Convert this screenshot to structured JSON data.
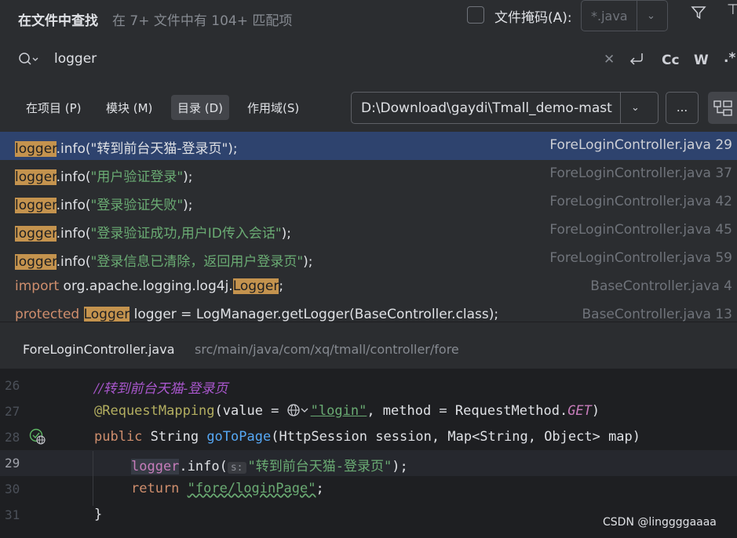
{
  "header": {
    "title": "在文件中查找",
    "subtitle": "在 7+ 文件中有 104+ 匹配项",
    "file_mask_label": "文件掩码(A):",
    "file_mask_value": "*.java"
  },
  "search": {
    "query": "logger",
    "case_toggle": "Cc",
    "word_toggle": "W",
    "regex_toggle": ".*"
  },
  "scope": {
    "tabs": [
      {
        "label": "在项目 (P)"
      },
      {
        "label": "模块 (M)"
      },
      {
        "label": "目录 (D)",
        "active": true
      },
      {
        "label": "作用域(S)"
      }
    ],
    "directory": "D:\\Download\\gaydi\\Tmall_demo-mast",
    "browse_label": "..."
  },
  "results": [
    {
      "match": "logger",
      "after": ".info(",
      "string": "\"转到前台天猫-登录页\"",
      "tail": ");",
      "file": "ForeLoginController.java 29",
      "selected": true
    },
    {
      "match": "logger",
      "after": ".info(",
      "string": "\"用户验证登录\"",
      "tail": ");",
      "file": "ForeLoginController.java 37"
    },
    {
      "match": "logger",
      "after": ".info(",
      "string": "\"登录验证失败\"",
      "tail": ");",
      "file": "ForeLoginController.java 42"
    },
    {
      "match": "logger",
      "after": ".info(",
      "string": "\"登录验证成功,用户ID传入会话\"",
      "tail": ");",
      "file": "ForeLoginController.java 45"
    },
    {
      "match": "logger",
      "after": ".info(",
      "string": "\"登录信息已清除，返回用户登录页\"",
      "tail": ");",
      "file": "ForeLoginController.java 59"
    },
    {
      "prefix_kw": "import",
      "prefix": " org.apache.logging.log4j.",
      "match": "Logger",
      "tail": ";",
      "file": "BaseController.java 4"
    },
    {
      "prefix_kw": "protected",
      "prefix": " ",
      "match": "Logger",
      "tail": " logger = LogManager.getLogger(BaseController.class);",
      "file": "BaseController.java 13"
    }
  ],
  "preview": {
    "file_name": "ForeLoginController.java",
    "file_path": "src/main/java/com/xq/tmall/controller/fore"
  },
  "code": {
    "lines": [
      {
        "no": "26"
      },
      {
        "no": "27"
      },
      {
        "no": "28"
      },
      {
        "no": "29"
      },
      {
        "no": "30"
      },
      {
        "no": "31"
      }
    ],
    "l26_comment": "//转到前台天猫-登录页",
    "l27_annot": "@RequestMapping",
    "l27_a": "(value = ",
    "l27_str": "\"login\"",
    "l27_b": ", method = RequestMethod.",
    "l27_const": "GET",
    "l27_c": ")",
    "l28_kw": "public",
    "l28_a": " String ",
    "l28_fn": "goToPage",
    "l28_b": "(HttpSession session, Map<String, Object> map)",
    "l29_field": "logger",
    "l29_a": ".info(",
    "l29_hint": "s:",
    "l29_str": "\"转到前台天猫-登录页\"",
    "l29_b": ");",
    "l30_kw": "return",
    "l30_str": "\"fore/loginPage\"",
    "l30_b": ";",
    "l31": "}"
  },
  "watermark": "CSDN @linggggaaaa"
}
